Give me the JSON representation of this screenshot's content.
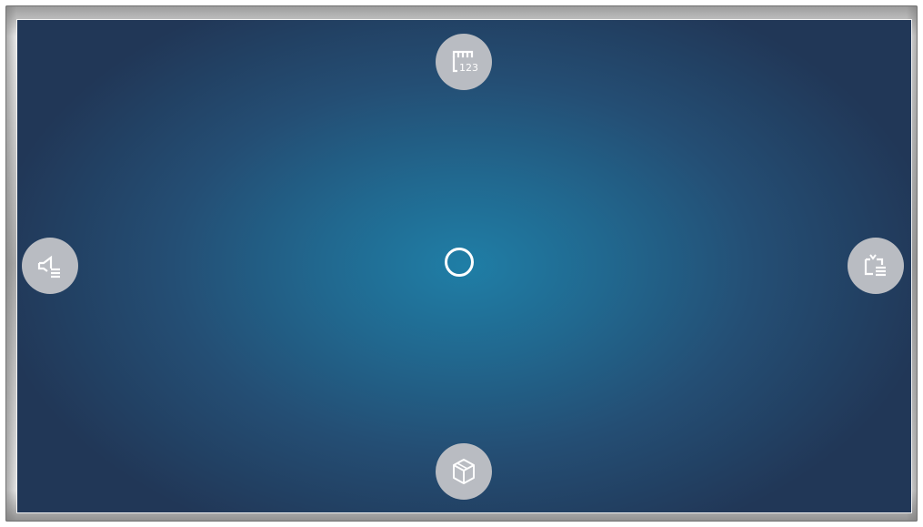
{
  "screen": {
    "center_indicator": "focus-ring",
    "background_colors": [
      "#1f7ea6",
      "#244e74",
      "#213757"
    ]
  },
  "buttons": {
    "top": {
      "icon": "number-pad-icon",
      "label": "123"
    },
    "left": {
      "icon": "speaker-list-icon"
    },
    "right": {
      "icon": "tv-list-icon"
    },
    "bottom": {
      "icon": "cube-icon"
    }
  },
  "colors": {
    "button_fill": "#b9bcc2",
    "icon_stroke": "#ffffff",
    "bezel": "#bdbdbd"
  }
}
